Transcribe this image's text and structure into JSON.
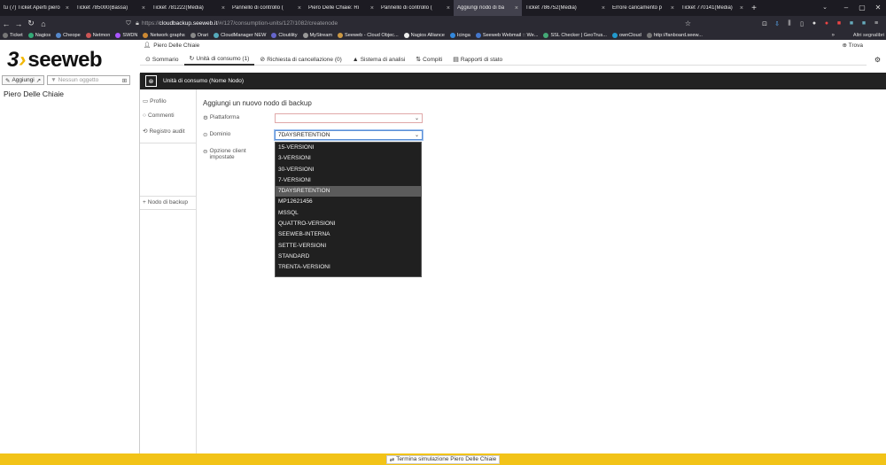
{
  "browser": {
    "tabs": [
      {
        "title": "(7) Ticket Aperti piero",
        "close": "×",
        "prefix": "tu"
      },
      {
        "title": "Ticket 785000(Bassa)",
        "close": "×"
      },
      {
        "title": "Ticket 781222(Media)",
        "close": "×"
      },
      {
        "title": "Pannello di controllo (",
        "close": "×"
      },
      {
        "title": "Piero Delle Chiaie: Ri",
        "close": "×"
      },
      {
        "title": "Pannello di controllo (",
        "close": "×"
      },
      {
        "title": "Aggiungi nodo di ba",
        "close": "×"
      },
      {
        "title": "Ticket 786752(Media)",
        "close": "×"
      },
      {
        "title": "Errore caricamento p",
        "close": "×"
      },
      {
        "title": "Ticket 770141(Media)",
        "close": "×"
      }
    ],
    "active_tab_index": 6,
    "new_tab": "+",
    "tab_list": "⌄",
    "window_controls": {
      "minimize": "–",
      "maximize": "▢",
      "close": "✕"
    },
    "url_prefix": "https://",
    "url_host": "cloudbackup.seeweb.it",
    "url_path": "/#/127/consumption-units/127/1082/createnode",
    "bookmarks": [
      "Ticket",
      "Nagios",
      "Cheope",
      "Netmon",
      "SWDN",
      "Network graphs",
      "Orari",
      "CloudManager NEW",
      "Cloutility",
      "MyStream",
      "Seeweb - Cloud Objec...",
      "Nagios Alliance",
      "Icinga",
      "Seeweb Webmail :: We...",
      "SSL Checker | GeoTrus...",
      "ownCloud",
      "http://fanboard.seew..."
    ],
    "bookmarks_more": "»",
    "other_bookmarks": "Altri segnalibri"
  },
  "app": {
    "logo_text": "seeweb",
    "user_name": "Piero Delle Chiaie",
    "find_label": "Trova",
    "nav": [
      {
        "label": "Sommario",
        "icon": "⊙",
        "active": false
      },
      {
        "label": "Unità di consumo (1)",
        "icon": "↻",
        "active": true
      },
      {
        "label": "Richiesta di cancellazione (0)",
        "icon": "⊘",
        "active": false
      },
      {
        "label": "Sistema di analisi",
        "icon": "▲",
        "active": false
      },
      {
        "label": "Compiti",
        "icon": "⇅",
        "active": false
      },
      {
        "label": "Rapporti di stato",
        "icon": "▤",
        "active": false
      }
    ],
    "left": {
      "add_label": "Aggiungi",
      "filter_placeholder": "Nessun oggetto",
      "entity_name": "Piero Delle Chiaie"
    },
    "header_title": "Unità di consumo (Nome Nodo)",
    "subnav": [
      {
        "label": "Profilo",
        "icon": "▭"
      },
      {
        "label": "Commenti",
        "icon": "○"
      },
      {
        "label": "Registro audit",
        "icon": "⟲"
      },
      {
        "label": "Nodo di backup",
        "icon": "+"
      }
    ],
    "form": {
      "title": "Aggiungi un nuovo nodo di backup",
      "platform_label": "Piattaforma",
      "platform_value": "",
      "domain_label": "Dominio",
      "domain_value": "7DAYSRETENTION",
      "client_options_label": "Opzione client impostate"
    },
    "domain_options": [
      "15-VERSIONI",
      "3-VERSIONI",
      "30-VERSIONI",
      "7-VERSIONI",
      "7DAYSRETENTION",
      "MP12621456",
      "MSSQL",
      "QUATTRO-VERSIONI",
      "SEEWEB-INTERNA",
      "SETTE-VERSIONI",
      "STANDARD",
      "TRENTA-VERSIONI"
    ],
    "selected_option_index": 4,
    "end_simulation_label": "Termina simulazione Piero Delle Chiaie"
  }
}
